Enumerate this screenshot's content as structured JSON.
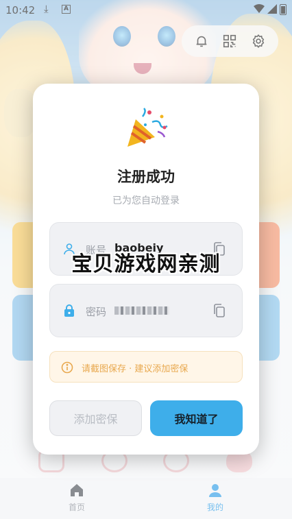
{
  "status_bar": {
    "time": "10:42",
    "a_badge": "A"
  },
  "top_icons": [
    "bell-icon",
    "qr-scan-icon",
    "gear-icon"
  ],
  "dialog": {
    "emoji": "party-popper",
    "title": "注册成功",
    "subtitle": "已为您自动登录",
    "account": {
      "label": "账号",
      "value": "baobeiy"
    },
    "password": {
      "label": "密码",
      "value": "••••••••"
    },
    "tip": "请截图保存 · 建议添加密保",
    "secondary_button": "添加密保",
    "primary_button": "我知道了"
  },
  "watermark": "宝贝游戏网亲测",
  "bottom_nav": [
    {
      "label": "首页",
      "icon": "home-icon",
      "active": false
    },
    {
      "label": "我的",
      "icon": "user-icon",
      "active": true
    }
  ],
  "colors": {
    "accent": "#3eaeea",
    "tip_text": "#e8a84e",
    "tip_bg": "#fff6e8"
  }
}
